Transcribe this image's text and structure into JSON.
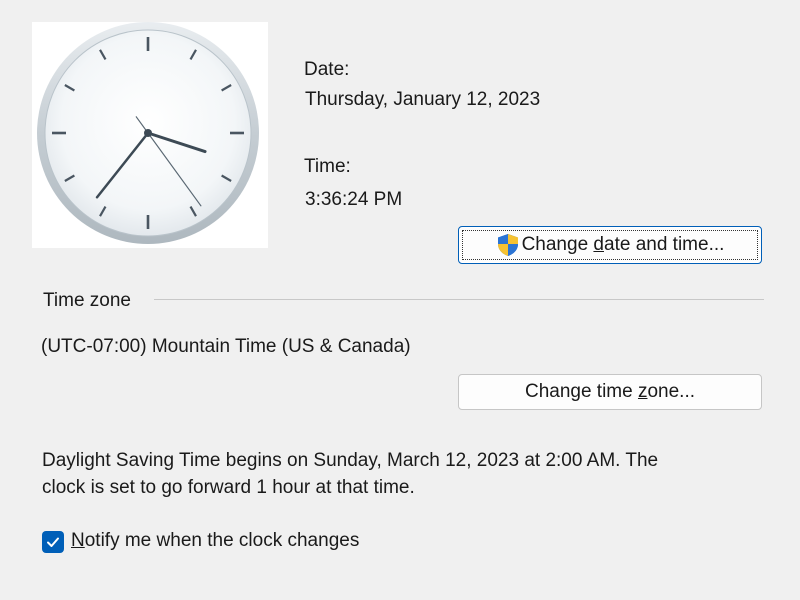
{
  "clock": {
    "hours": 3,
    "minutes": 36,
    "seconds": 24
  },
  "date": {
    "label": "Date:",
    "value": "Thursday, January 12, 2023"
  },
  "time": {
    "label": "Time:",
    "value": "3:36:24 PM"
  },
  "change_datetime_button": {
    "icon": "uac-shield-icon",
    "label_pre": "Change ",
    "label_accel": "d",
    "label_post": "ate and time..."
  },
  "timezone": {
    "group_label": "Time zone",
    "value": "(UTC-07:00) Mountain Time (US & Canada)",
    "button_label_pre": "Change time ",
    "button_label_accel": "z",
    "button_label_post": "one..."
  },
  "dst": {
    "line1": "Daylight Saving Time begins on Sunday, March 12, 2023 at 2:00 AM. The",
    "line2": "clock is set to go forward 1 hour at that time."
  },
  "notify": {
    "checked": true,
    "label_accel": "N",
    "label_rest": "otify me when the clock changes"
  },
  "colors": {
    "accent": "#005fb8",
    "background": "#f0f0f0"
  }
}
